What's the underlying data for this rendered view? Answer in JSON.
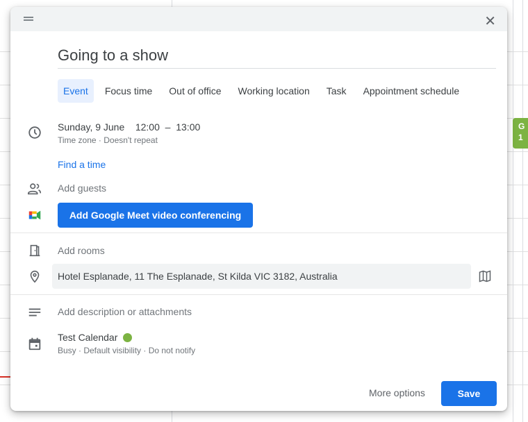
{
  "background_event": {
    "line1": "G",
    "line2": "1",
    "color": "#7cb342"
  },
  "dialog": {
    "title": "Going to a show",
    "tabs": [
      {
        "label": "Event",
        "active": true
      },
      {
        "label": "Focus time"
      },
      {
        "label": "Out of office"
      },
      {
        "label": "Working location"
      },
      {
        "label": "Task"
      },
      {
        "label": "Appointment schedule"
      }
    ],
    "date": "Sunday, 9 June",
    "start_time": "12:00",
    "dash": "–",
    "end_time": "13:00",
    "time_sub": "Time zone · Doesn't repeat",
    "find_time": "Find a time",
    "add_guests": "Add guests",
    "meet_button": "Add Google Meet video conferencing",
    "add_rooms": "Add rooms",
    "location": "Hotel Esplanade, 11 The Esplanade, St Kilda VIC 3182, Australia",
    "description_placeholder": "Add description or attachments",
    "calendar_name": "Test Calendar",
    "calendar_color": "#7cb342",
    "calendar_sub": "Busy · Default visibility · Do not notify",
    "more_options": "More options",
    "save": "Save",
    "accent": "#1a73e8"
  }
}
